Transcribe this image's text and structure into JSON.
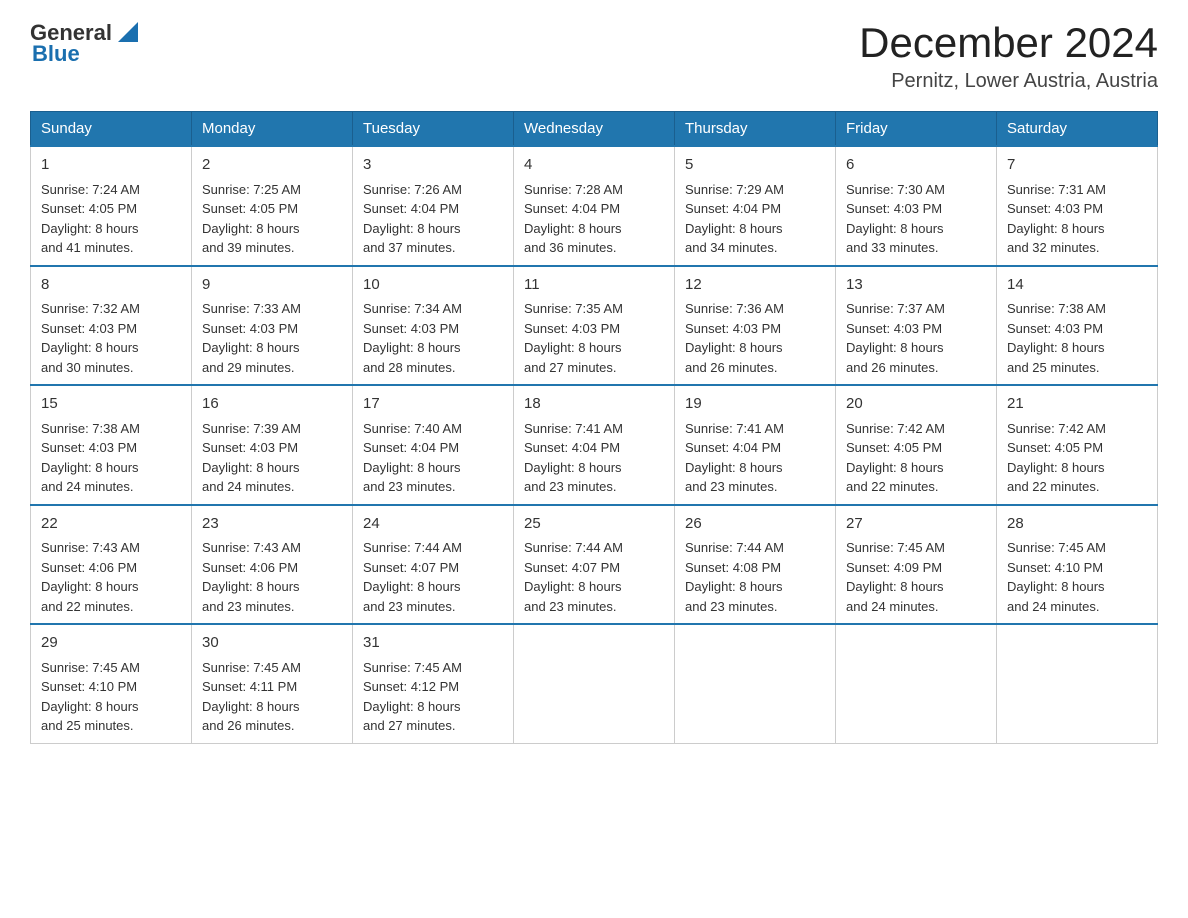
{
  "header": {
    "logo_general": "General",
    "logo_blue": "Blue",
    "month_year": "December 2024",
    "location": "Pernitz, Lower Austria, Austria"
  },
  "days_of_week": [
    "Sunday",
    "Monday",
    "Tuesday",
    "Wednesday",
    "Thursday",
    "Friday",
    "Saturday"
  ],
  "weeks": [
    [
      {
        "day": "1",
        "sunrise": "7:24 AM",
        "sunset": "4:05 PM",
        "daylight": "8 hours and 41 minutes."
      },
      {
        "day": "2",
        "sunrise": "7:25 AM",
        "sunset": "4:05 PM",
        "daylight": "8 hours and 39 minutes."
      },
      {
        "day": "3",
        "sunrise": "7:26 AM",
        "sunset": "4:04 PM",
        "daylight": "8 hours and 37 minutes."
      },
      {
        "day": "4",
        "sunrise": "7:28 AM",
        "sunset": "4:04 PM",
        "daylight": "8 hours and 36 minutes."
      },
      {
        "day": "5",
        "sunrise": "7:29 AM",
        "sunset": "4:04 PM",
        "daylight": "8 hours and 34 minutes."
      },
      {
        "day": "6",
        "sunrise": "7:30 AM",
        "sunset": "4:03 PM",
        "daylight": "8 hours and 33 minutes."
      },
      {
        "day": "7",
        "sunrise": "7:31 AM",
        "sunset": "4:03 PM",
        "daylight": "8 hours and 32 minutes."
      }
    ],
    [
      {
        "day": "8",
        "sunrise": "7:32 AM",
        "sunset": "4:03 PM",
        "daylight": "8 hours and 30 minutes."
      },
      {
        "day": "9",
        "sunrise": "7:33 AM",
        "sunset": "4:03 PM",
        "daylight": "8 hours and 29 minutes."
      },
      {
        "day": "10",
        "sunrise": "7:34 AM",
        "sunset": "4:03 PM",
        "daylight": "8 hours and 28 minutes."
      },
      {
        "day": "11",
        "sunrise": "7:35 AM",
        "sunset": "4:03 PM",
        "daylight": "8 hours and 27 minutes."
      },
      {
        "day": "12",
        "sunrise": "7:36 AM",
        "sunset": "4:03 PM",
        "daylight": "8 hours and 26 minutes."
      },
      {
        "day": "13",
        "sunrise": "7:37 AM",
        "sunset": "4:03 PM",
        "daylight": "8 hours and 26 minutes."
      },
      {
        "day": "14",
        "sunrise": "7:38 AM",
        "sunset": "4:03 PM",
        "daylight": "8 hours and 25 minutes."
      }
    ],
    [
      {
        "day": "15",
        "sunrise": "7:38 AM",
        "sunset": "4:03 PM",
        "daylight": "8 hours and 24 minutes."
      },
      {
        "day": "16",
        "sunrise": "7:39 AM",
        "sunset": "4:03 PM",
        "daylight": "8 hours and 24 minutes."
      },
      {
        "day": "17",
        "sunrise": "7:40 AM",
        "sunset": "4:04 PM",
        "daylight": "8 hours and 23 minutes."
      },
      {
        "day": "18",
        "sunrise": "7:41 AM",
        "sunset": "4:04 PM",
        "daylight": "8 hours and 23 minutes."
      },
      {
        "day": "19",
        "sunrise": "7:41 AM",
        "sunset": "4:04 PM",
        "daylight": "8 hours and 23 minutes."
      },
      {
        "day": "20",
        "sunrise": "7:42 AM",
        "sunset": "4:05 PM",
        "daylight": "8 hours and 22 minutes."
      },
      {
        "day": "21",
        "sunrise": "7:42 AM",
        "sunset": "4:05 PM",
        "daylight": "8 hours and 22 minutes."
      }
    ],
    [
      {
        "day": "22",
        "sunrise": "7:43 AM",
        "sunset": "4:06 PM",
        "daylight": "8 hours and 22 minutes."
      },
      {
        "day": "23",
        "sunrise": "7:43 AM",
        "sunset": "4:06 PM",
        "daylight": "8 hours and 23 minutes."
      },
      {
        "day": "24",
        "sunrise": "7:44 AM",
        "sunset": "4:07 PM",
        "daylight": "8 hours and 23 minutes."
      },
      {
        "day": "25",
        "sunrise": "7:44 AM",
        "sunset": "4:07 PM",
        "daylight": "8 hours and 23 minutes."
      },
      {
        "day": "26",
        "sunrise": "7:44 AM",
        "sunset": "4:08 PM",
        "daylight": "8 hours and 23 minutes."
      },
      {
        "day": "27",
        "sunrise": "7:45 AM",
        "sunset": "4:09 PM",
        "daylight": "8 hours and 24 minutes."
      },
      {
        "day": "28",
        "sunrise": "7:45 AM",
        "sunset": "4:10 PM",
        "daylight": "8 hours and 24 minutes."
      }
    ],
    [
      {
        "day": "29",
        "sunrise": "7:45 AM",
        "sunset": "4:10 PM",
        "daylight": "8 hours and 25 minutes."
      },
      {
        "day": "30",
        "sunrise": "7:45 AM",
        "sunset": "4:11 PM",
        "daylight": "8 hours and 26 minutes."
      },
      {
        "day": "31",
        "sunrise": "7:45 AM",
        "sunset": "4:12 PM",
        "daylight": "8 hours and 27 minutes."
      },
      null,
      null,
      null,
      null
    ]
  ],
  "labels": {
    "sunrise": "Sunrise:",
    "sunset": "Sunset:",
    "daylight": "Daylight:"
  }
}
